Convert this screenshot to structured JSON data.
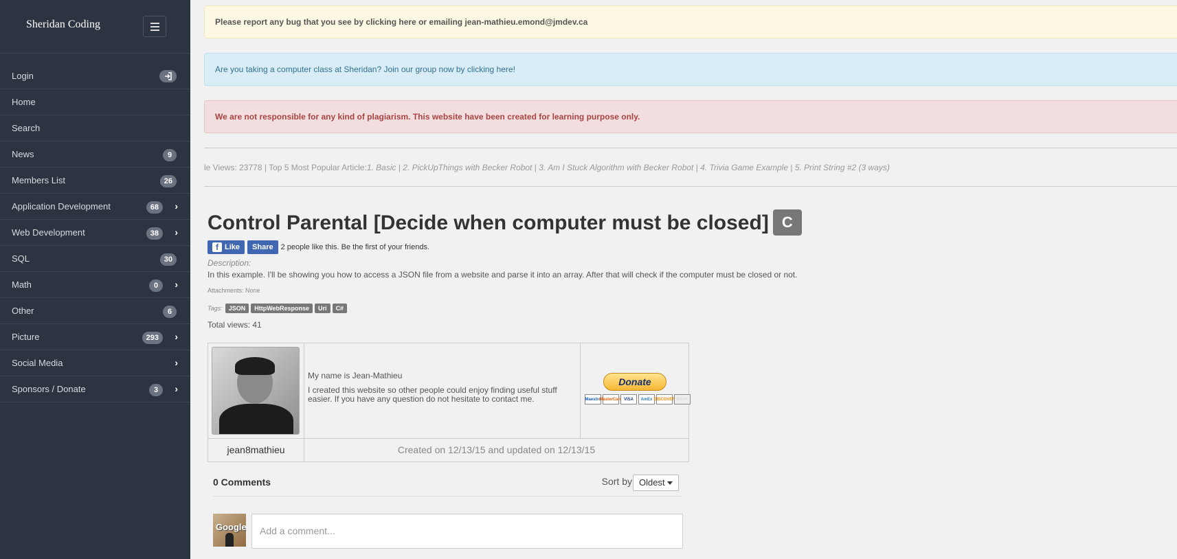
{
  "sidebar": {
    "brand": "Sheridan Coding",
    "items": [
      {
        "label": "Login",
        "badge": null,
        "chevron": false,
        "icon": "login-icon"
      },
      {
        "label": "Home",
        "badge": null,
        "chevron": false
      },
      {
        "label": "Search",
        "badge": null,
        "chevron": false
      },
      {
        "label": "News",
        "badge": "9",
        "chevron": false
      },
      {
        "label": "Members List",
        "badge": "26",
        "chevron": false
      },
      {
        "label": "Application Development",
        "badge": "68",
        "chevron": true
      },
      {
        "label": "Web Development",
        "badge": "38",
        "chevron": true
      },
      {
        "label": "SQL",
        "badge": "30",
        "chevron": false
      },
      {
        "label": "Math",
        "badge": "0",
        "chevron": true
      },
      {
        "label": "Other",
        "badge": "6",
        "chevron": false
      },
      {
        "label": "Picture",
        "badge": "293",
        "chevron": true
      },
      {
        "label": "Social Media",
        "badge": null,
        "chevron": true
      },
      {
        "label": "Sponsors / Donate",
        "badge": "3",
        "chevron": true
      }
    ]
  },
  "alerts": {
    "bug": "Please report any bug that you see by clicking here or emailing jean-mathieu.emond@jmdev.ca",
    "join": "Are you taking a computer class at Sheridan? Join our group now by clicking here!",
    "plagiarism": "We are not responsible for any kind of plagiarism. This website have been created for learning purpose only."
  },
  "ticker": {
    "prefix": "le Views: 23778 | Top 5 Most Popular Article: ",
    "items": [
      "1. Basic",
      "2. PickUpThings with Becker Robot",
      "3. Am I Stuck Algorithm with Becker Robot",
      "4. Trivia Game Example",
      "5. Print String #2 (3 ways)"
    ]
  },
  "article": {
    "title": "Control Parental [Decide when computer must be closed]",
    "language_badge": "C",
    "fb_like": "Like",
    "fb_share": "Share",
    "fb_text": "2 people like this. Be the first of your friends.",
    "description_label": "Description:",
    "description": "In this example. I'll be showing you how to access a JSON file from a website and parse it into an array. After that will check if the computer must be closed or not.",
    "attachments": "Attachments: None",
    "tags_label": "Tags:",
    "tags": [
      "JSON",
      "HttpWebResponse",
      "Uri",
      "C#"
    ],
    "total_views": "Total views: 41"
  },
  "author": {
    "name_line": "My name is Jean-Mathieu",
    "bio": "I created this website so other people could enjoy finding useful stuff easier. If you have any question do not hesitate to contact me.",
    "donate_label": "Donate",
    "cards": [
      "Maestro",
      "MasterCard",
      "VISA",
      "AmEx",
      "DISCOVER",
      "BANK"
    ],
    "username": "jean8mathieu",
    "dates": "Created on 12/13/15 and updated on 12/13/15"
  },
  "comments": {
    "count": "0 Comments",
    "sort_label": "Sort by",
    "sort_value": "Oldest",
    "placeholder": "Add a comment..."
  }
}
